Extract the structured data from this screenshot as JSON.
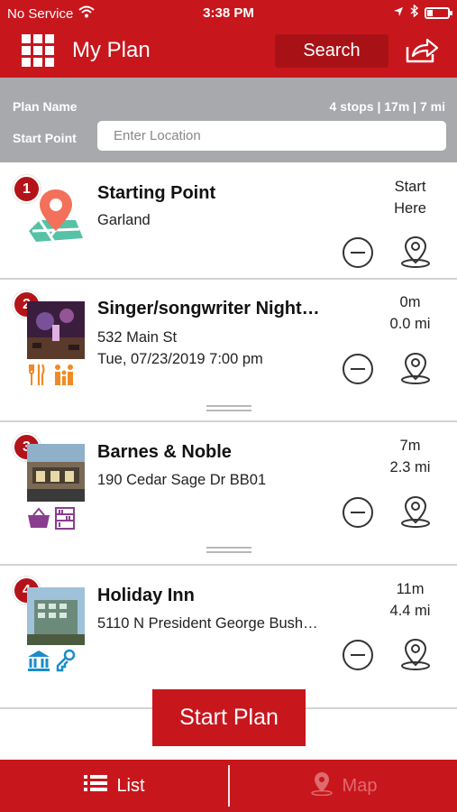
{
  "status_bar": {
    "carrier": "No Service",
    "time": "3:38 PM",
    "battery_level": 0.25
  },
  "nav": {
    "title": "My Plan",
    "search_label": "Search"
  },
  "plan": {
    "name_label": "Plan Name",
    "stats": "4 stops | 17m | 7 mi",
    "start_point_label": "Start Point",
    "location_placeholder": "Enter Location"
  },
  "stops": [
    {
      "number": "1",
      "title": "Starting Point",
      "line1": "Garland",
      "time_line1": "Start",
      "time_line2": "Here",
      "icon": "map-pin-icon"
    },
    {
      "number": "2",
      "title": "Singer/songwriter Night…",
      "line1": "532 Main St",
      "line2": "Tue, 07/23/2019 7:00 pm",
      "time_line1": "0m",
      "time_line2": "0.0 mi",
      "categories": [
        "dining-icon",
        "family-icon"
      ]
    },
    {
      "number": "3",
      "title": "Barnes & Noble",
      "line1": "190 Cedar Sage Dr BB01",
      "time_line1": "7m",
      "time_line2": "2.3 mi",
      "categories": [
        "shopping-basket-icon",
        "bookshelf-icon"
      ]
    },
    {
      "number": "4",
      "title": "Holiday Inn",
      "line1": "5110 N President George Bush…",
      "time_line1": "11m",
      "time_line2": "4.4 mi",
      "categories": [
        "museum-icon",
        "hotel-key-icon"
      ]
    }
  ],
  "start_plan_label": "Start Plan",
  "tabs": {
    "list": "List",
    "map": "Map"
  },
  "colors": {
    "brand_red": "#c8161d",
    "dark_red": "#a81217",
    "header_gray": "#a7a9ac",
    "category_orange": "#f08a24",
    "category_purple": "#8a3d8f",
    "category_blue": "#1a8dc9"
  }
}
